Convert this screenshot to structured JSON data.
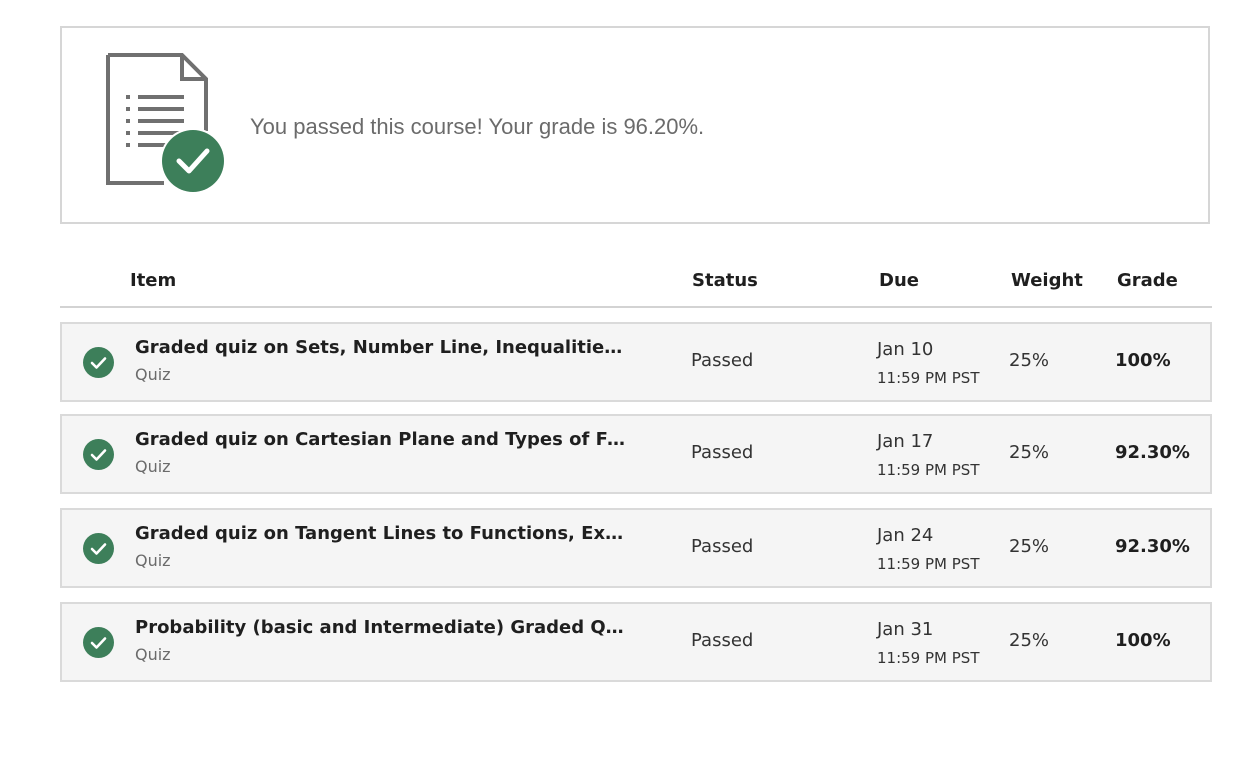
{
  "banner": {
    "message": "You passed this course! Your grade is 96.20%.",
    "icon": "document-check-icon"
  },
  "table": {
    "headers": {
      "item": "Item",
      "status": "Status",
      "due": "Due",
      "weight": "Weight",
      "grade": "Grade"
    },
    "rows": [
      {
        "title": "Graded quiz on Sets, Number Line, Inequalities, Si...",
        "type": "Quiz",
        "status": "Passed",
        "due_date": "Jan 10",
        "due_time": "11:59 PM PST",
        "weight": "25%",
        "grade": "100%"
      },
      {
        "title": "Graded quiz on Cartesian Plane and Types of Funct...",
        "type": "Quiz",
        "status": "Passed",
        "due_date": "Jan 17",
        "due_time": "11:59 PM PST",
        "weight": "25%",
        "grade": "92.30%"
      },
      {
        "title": "Graded quiz on Tangent Lines to Functions, Expon...",
        "type": "Quiz",
        "status": "Passed",
        "due_date": "Jan 24",
        "due_time": "11:59 PM PST",
        "weight": "25%",
        "grade": "92.30%"
      },
      {
        "title": "Probability (basic and Intermediate) Graded Quiz",
        "type": "Quiz",
        "status": "Passed",
        "due_date": "Jan 31",
        "due_time": "11:59 PM PST",
        "weight": "25%",
        "grade": "100%"
      }
    ]
  },
  "colors": {
    "success_green": "#3d7f5a",
    "icon_gray": "#707070",
    "border": "#d6d6d6",
    "row_bg": "#f5f5f5"
  }
}
